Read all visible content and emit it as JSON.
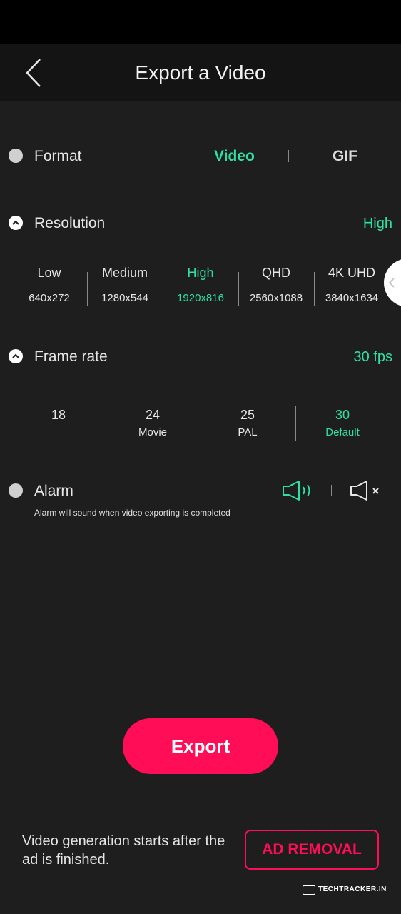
{
  "header": {
    "title": "Export a Video"
  },
  "format": {
    "label": "Format",
    "options": [
      "Video",
      "GIF"
    ],
    "selected": "Video"
  },
  "resolution": {
    "label": "Resolution",
    "current": "High",
    "options": [
      {
        "name": "Low",
        "dims": "640x272"
      },
      {
        "name": "Medium",
        "dims": "1280x544"
      },
      {
        "name": "High",
        "dims": "1920x816"
      },
      {
        "name": "QHD",
        "dims": "2560x1088"
      },
      {
        "name": "4K UHD",
        "dims": "3840x1634"
      }
    ]
  },
  "frame_rate": {
    "label": "Frame rate",
    "current": "30 fps",
    "options": [
      {
        "value": "18",
        "sub": ""
      },
      {
        "value": "24",
        "sub": "Movie"
      },
      {
        "value": "25",
        "sub": "PAL"
      },
      {
        "value": "30",
        "sub": "Default"
      }
    ]
  },
  "alarm": {
    "label": "Alarm",
    "note": "Alarm will sound when video exporting is completed",
    "icons": [
      "speaker-on-icon",
      "speaker-mute-icon"
    ]
  },
  "actions": {
    "export_label": "Export",
    "ad_removal_label": "AD REMOVAL"
  },
  "footer": {
    "message": "Video generation starts after the ad is finished."
  },
  "watermark": {
    "text": "TECHTRACKER.IN"
  },
  "colors": {
    "accent": "#2fe0a6",
    "brand": "#ff0d56",
    "background": "#1e1e1e"
  }
}
